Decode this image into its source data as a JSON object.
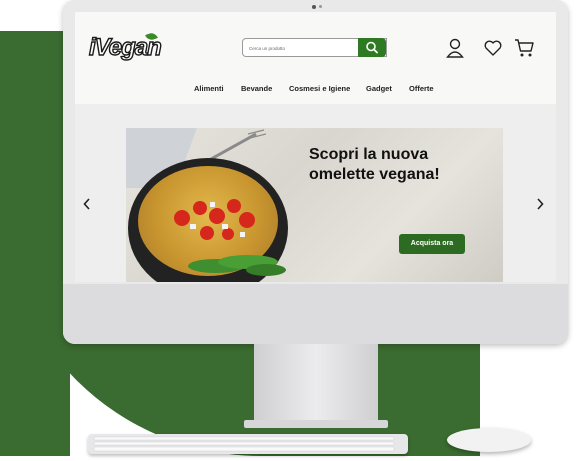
{
  "brand": {
    "logo_text": "iVegan",
    "accent": "#2e7a23",
    "backdrop": "#3a6b30"
  },
  "search": {
    "placeholder": "Cerca un prodotto",
    "button_icon": "search-icon"
  },
  "header_icons": [
    "user-icon",
    "heart-icon",
    "cart-icon"
  ],
  "nav": {
    "items": [
      "Alimenti",
      "Bevande",
      "Cosmesi e Igiene",
      "Gadget",
      "Offerte"
    ]
  },
  "hero": {
    "title_line1": "Scopri la nuova",
    "title_line2": "omelette vegana!",
    "cta_label": "Acquista ora",
    "prev_icon": "chevron-left-icon",
    "next_icon": "chevron-right-icon"
  }
}
